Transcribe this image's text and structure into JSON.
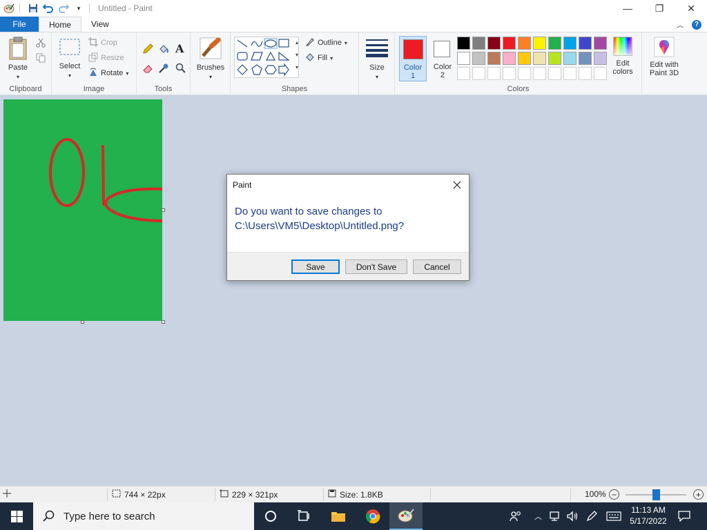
{
  "window": {
    "title": "Untitled - Paint",
    "min_glyph": "—",
    "max_glyph": "❐",
    "close_glyph": "✕"
  },
  "tabs": [
    {
      "label": "File"
    },
    {
      "label": "Home"
    },
    {
      "label": "View"
    }
  ],
  "ribbon": {
    "clipboard": {
      "group_label": "Clipboard",
      "paste_label": "Paste"
    },
    "image": {
      "group_label": "Image",
      "select_label": "Select",
      "crop_label": "Crop",
      "resize_label": "Resize",
      "rotate_label": "Rotate"
    },
    "tools": {
      "group_label": "Tools"
    },
    "brushes": {
      "label": "Brushes"
    },
    "shapes": {
      "group_label": "Shapes",
      "outline_label": "Outline",
      "fill_label": "Fill"
    },
    "size": {
      "label": "Size"
    },
    "colors": {
      "group_label": "Colors",
      "color1_label": "Color",
      "color1_num": "1",
      "color2_label": "Color",
      "color2_num": "2",
      "color1_value": "#ed1c24",
      "color2_value": "#ffffff",
      "edit_colors_label": "Edit colors",
      "paint3d_label": "Edit with Paint 3D",
      "palette_row1": [
        "#000000",
        "#7f7f7f",
        "#880015",
        "#ed1c24",
        "#ff7f27",
        "#fff200",
        "#22b14c",
        "#00a2e8",
        "#3f48cc",
        "#a349a4"
      ],
      "palette_row2": [
        "#ffffff",
        "#c3c3c3",
        "#b97a57",
        "#ffaec9",
        "#ffc90e",
        "#efe4b0",
        "#b5e61d",
        "#99d9ea",
        "#7092be",
        "#c8bfe7"
      ],
      "palette_row3": [
        "#ffffff",
        "#ffffff",
        "#ffffff",
        "#ffffff",
        "#ffffff",
        "#ffffff",
        "#ffffff",
        "#ffffff",
        "#ffffff",
        "#ffffff"
      ]
    }
  },
  "canvas": {
    "background": "#22b14c",
    "stroke_color": "#d42a2a"
  },
  "dialog": {
    "title": "Paint",
    "message_line1": "Do you want to save changes to",
    "message_line2": "C:\\Users\\VM5\\Desktop\\Untitled.png?",
    "save_label": "Save",
    "dont_save_label": "Don't Save",
    "cancel_label": "Cancel"
  },
  "statusbar": {
    "selection_size": "744 × 22px",
    "canvas_size": "229 × 321px",
    "file_size": "Size: 1.8KB",
    "zoom": "100%",
    "zoom_level": 0.5
  },
  "taskbar": {
    "search_placeholder": "Type here to search",
    "time": "11:13 AM",
    "date": "5/17/2022"
  }
}
